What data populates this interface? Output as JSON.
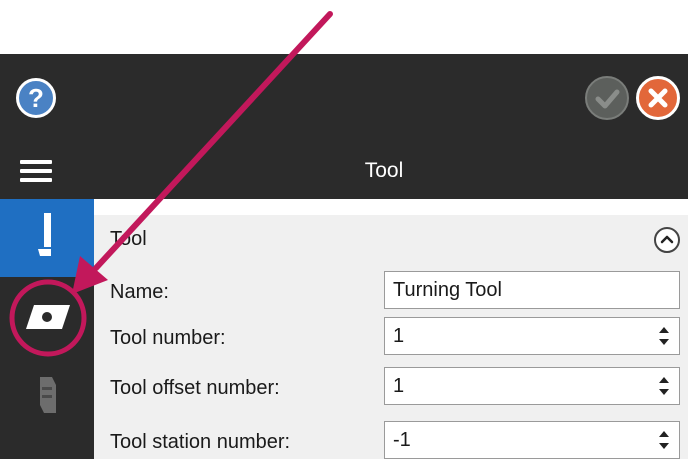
{
  "window": {
    "title": "Tool",
    "help_icon": "question-icon",
    "ok_icon": "check-icon",
    "cancel_icon": "close-icon",
    "menu_icon": "hamburger-icon"
  },
  "sidebar": {
    "tabs": [
      {
        "icon": "tool-holder-icon",
        "active": true
      },
      {
        "icon": "insert-icon",
        "active": false,
        "highlighted": true
      },
      {
        "icon": "holder-icon",
        "active": false
      }
    ]
  },
  "section": {
    "title": "Tool",
    "collapse_icon": "chevron-up-icon"
  },
  "form": {
    "fields": [
      {
        "label": "Name:",
        "value": "Turning Tool"
      },
      {
        "label": "Tool number:",
        "value": "1"
      },
      {
        "label": "Tool offset number:",
        "value": "1"
      },
      {
        "label": "Tool station number:",
        "value": "-1"
      }
    ]
  },
  "colors": {
    "dark_bg": "#2b2b2b",
    "accent_blue": "#1f6fc2",
    "annotation": "#c2185b",
    "cancel": "#e2673a"
  }
}
